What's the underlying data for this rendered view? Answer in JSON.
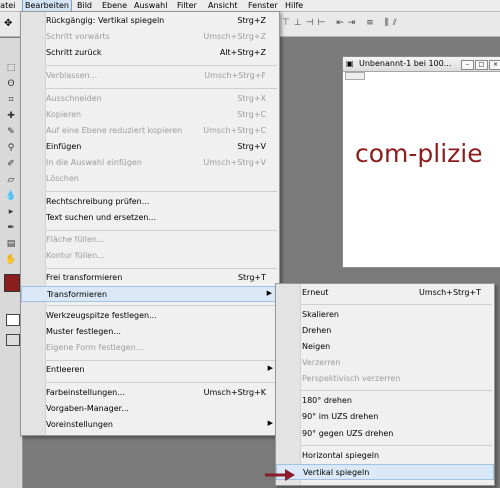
{
  "menubar": {
    "items": [
      {
        "label": "Datei"
      },
      {
        "label": "Bearbeiten"
      },
      {
        "label": "Bild"
      },
      {
        "label": "Ebene"
      },
      {
        "label": "Auswahl"
      },
      {
        "label": "Filter"
      },
      {
        "label": "Ansicht"
      },
      {
        "label": "Fenster"
      },
      {
        "label": "Hilfe"
      }
    ]
  },
  "document": {
    "title": "Unbenannt-1 bei 100...",
    "canvas_text": "com-plizie",
    "text_color": "#8b1d1d"
  },
  "edit_menu": {
    "items": [
      {
        "label": "Rückgängig: Vertikal spiegeln",
        "shortcut": "Strg+Z"
      },
      {
        "label": "Schritt vorwärts",
        "shortcut": "Umsch+Strg+Z"
      },
      {
        "label": "Schritt zurück",
        "shortcut": "Alt+Strg+Z"
      },
      {
        "label": "Verblassen...",
        "shortcut": "Umsch+Strg+F"
      },
      {
        "label": "Ausschneiden",
        "shortcut": "Strg+X"
      },
      {
        "label": "Kopieren",
        "shortcut": "Strg+C"
      },
      {
        "label": "Auf eine Ebene reduziert kopieren",
        "shortcut": "Umsch+Strg+C"
      },
      {
        "label": "Einfügen",
        "shortcut": "Strg+V"
      },
      {
        "label": "In die Auswahl einfügen",
        "shortcut": "Umsch+Strg+V"
      },
      {
        "label": "Löschen",
        "shortcut": ""
      },
      {
        "label": "Rechtschreibung prüfen...",
        "shortcut": ""
      },
      {
        "label": "Text suchen und ersetzen...",
        "shortcut": ""
      },
      {
        "label": "Fläche füllen...",
        "shortcut": ""
      },
      {
        "label": "Kontur füllen...",
        "shortcut": ""
      },
      {
        "label": "Frei transformieren",
        "shortcut": "Strg+T"
      },
      {
        "label": "Transformieren",
        "shortcut": ""
      },
      {
        "label": "Werkzeugspitze festlegen...",
        "shortcut": ""
      },
      {
        "label": "Muster festlegen...",
        "shortcut": ""
      },
      {
        "label": "Eigene Form festlegen...",
        "shortcut": ""
      },
      {
        "label": "Entleeren",
        "shortcut": ""
      },
      {
        "label": "Farbeinstellungen...",
        "shortcut": "Umsch+Strg+K"
      },
      {
        "label": "Vorgaben-Manager...",
        "shortcut": ""
      },
      {
        "label": "Voreinstellungen",
        "shortcut": ""
      }
    ]
  },
  "transform_submenu": {
    "items": [
      {
        "label": "Erneut",
        "shortcut": "Umsch+Strg+T"
      },
      {
        "label": "Skalieren"
      },
      {
        "label": "Drehen"
      },
      {
        "label": "Neigen"
      },
      {
        "label": "Verzerren"
      },
      {
        "label": "Perspektivisch verzerren"
      },
      {
        "label": "180° drehen"
      },
      {
        "label": "90° im UZS drehen"
      },
      {
        "label": "90° gegen UZS drehen"
      },
      {
        "label": "Horizontal spiegeln"
      },
      {
        "label": "Vertikal spiegeln"
      }
    ]
  },
  "colors": {
    "highlight": "#dbe8f7",
    "annotation_arrow": "#8b1d2a"
  }
}
